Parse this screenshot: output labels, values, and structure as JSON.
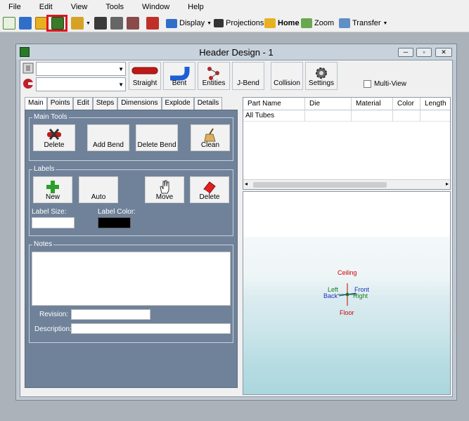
{
  "menu": [
    "File",
    "Edit",
    "View",
    "Tools",
    "Window",
    "Help"
  ],
  "toolbar": {
    "display": "Display",
    "projections": "Projections",
    "home": "Home",
    "zoom": "Zoom",
    "transfer": "Transfer"
  },
  "window": {
    "title": "Header Design - 1"
  },
  "ribbon": {
    "buttons": [
      "Straight",
      "Bent",
      "Entities",
      "J-Bend",
      "Collision",
      "Settings"
    ],
    "multiview": "Multi-View"
  },
  "tabs": [
    "Main",
    "Points",
    "Edit",
    "Steps",
    "Dimensions",
    "Explode",
    "Details"
  ],
  "main_tools": {
    "title": "Main Tools",
    "buttons": [
      "Delete",
      "Add Bend",
      "Delete Bend",
      "Clean"
    ]
  },
  "labels": {
    "title": "Labels",
    "buttons": [
      "New",
      "Auto",
      "Move",
      "Delete"
    ],
    "size_label": "Label Size:",
    "color_label": "Label Color:"
  },
  "notes": {
    "title": "Notes",
    "revision_label": "Revision:",
    "description_label": "Description:"
  },
  "grid": {
    "headers": [
      "Part Name",
      "Die",
      "Material",
      "Color",
      "Length"
    ],
    "rows": [
      [
        "All Tubes",
        "",
        "",
        "",
        ""
      ]
    ]
  },
  "viewport": {
    "ceiling": "Ceiling",
    "left": "Left",
    "back": "Back",
    "front": "Front",
    "right": "Right",
    "floor": "Floor"
  },
  "colors": {
    "highlight": "#e0141e",
    "panel": "#6f8299",
    "ceiling_floor": "#cc0000",
    "left_right": "#1a7a1a",
    "back_front": "#1a2fbb"
  }
}
